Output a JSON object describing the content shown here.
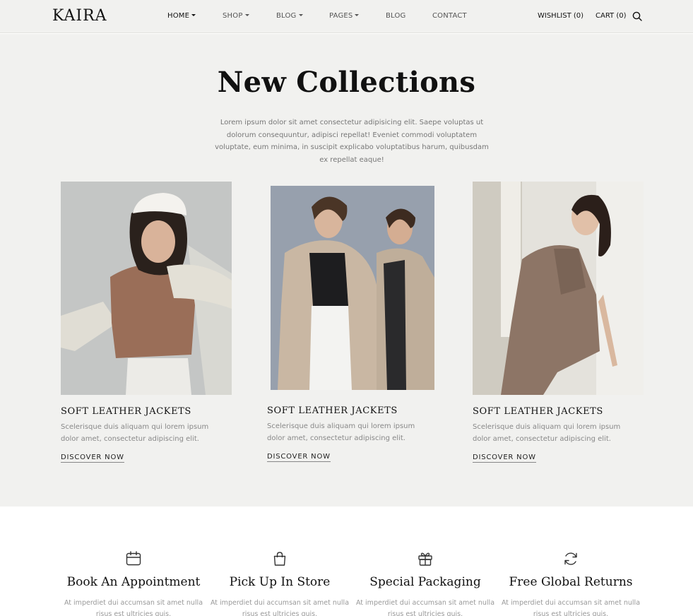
{
  "header": {
    "logo": "KAIRA",
    "nav": [
      {
        "label": "HOME",
        "dropdown": true
      },
      {
        "label": "SHOP",
        "dropdown": true
      },
      {
        "label": "BLOG",
        "dropdown": true
      },
      {
        "label": "PAGES",
        "dropdown": true
      },
      {
        "label": "BLOG",
        "dropdown": false
      },
      {
        "label": "CONTACT",
        "dropdown": false
      }
    ],
    "wishlist": "WISHLIST (0)",
    "cart": "CART (0)",
    "search_icon": "search-icon"
  },
  "hero": {
    "title": "New Collections",
    "intro": "Lorem ipsum dolor sit amet consectetur adipisicing elit. Saepe voluptas ut dolorum consequuntur, adipisci repellat! Eveniet commodi voluptatem voluptate, eum minima, in suscipit explicabo voluptatibus harum, quibusdam ex repellat eaque!"
  },
  "cards": [
    {
      "title": "SOFT LEATHER JACKETS",
      "desc": "Scelerisque duis aliquam qui lorem ipsum dolor amet, consectetur adipiscing elit.",
      "link": "DISCOVER NOW"
    },
    {
      "title": "SOFT LEATHER JACKETS",
      "desc": "Scelerisque duis aliquam qui lorem ipsum dolor amet, consectetur adipiscing elit.",
      "link": "DISCOVER NOW"
    },
    {
      "title": "SOFT LEATHER JACKETS",
      "desc": "Scelerisque duis aliquam qui lorem ipsum dolor amet, consectetur adipiscing elit.",
      "link": "DISCOVER NOW"
    }
  ],
  "features": [
    {
      "icon": "calendar-icon",
      "title": "Book An Appointment",
      "desc": "At imperdiet dui accumsan sit amet nulla risus est ultricies quis."
    },
    {
      "icon": "shopping-bag-icon",
      "title": "Pick Up In Store",
      "desc": "At imperdiet dui accumsan sit amet nulla risus est ultricies quis."
    },
    {
      "icon": "gift-icon",
      "title": "Special Packaging",
      "desc": "At imperdiet dui accumsan sit amet nulla risus est ultricies quis."
    },
    {
      "icon": "refresh-icon",
      "title": "Free Global Returns",
      "desc": "At imperdiet dui accumsan sit amet nulla risus est ultricies quis."
    }
  ],
  "colors": {
    "background": "#f1f1ef",
    "text": "#111111",
    "muted": "#888888"
  }
}
